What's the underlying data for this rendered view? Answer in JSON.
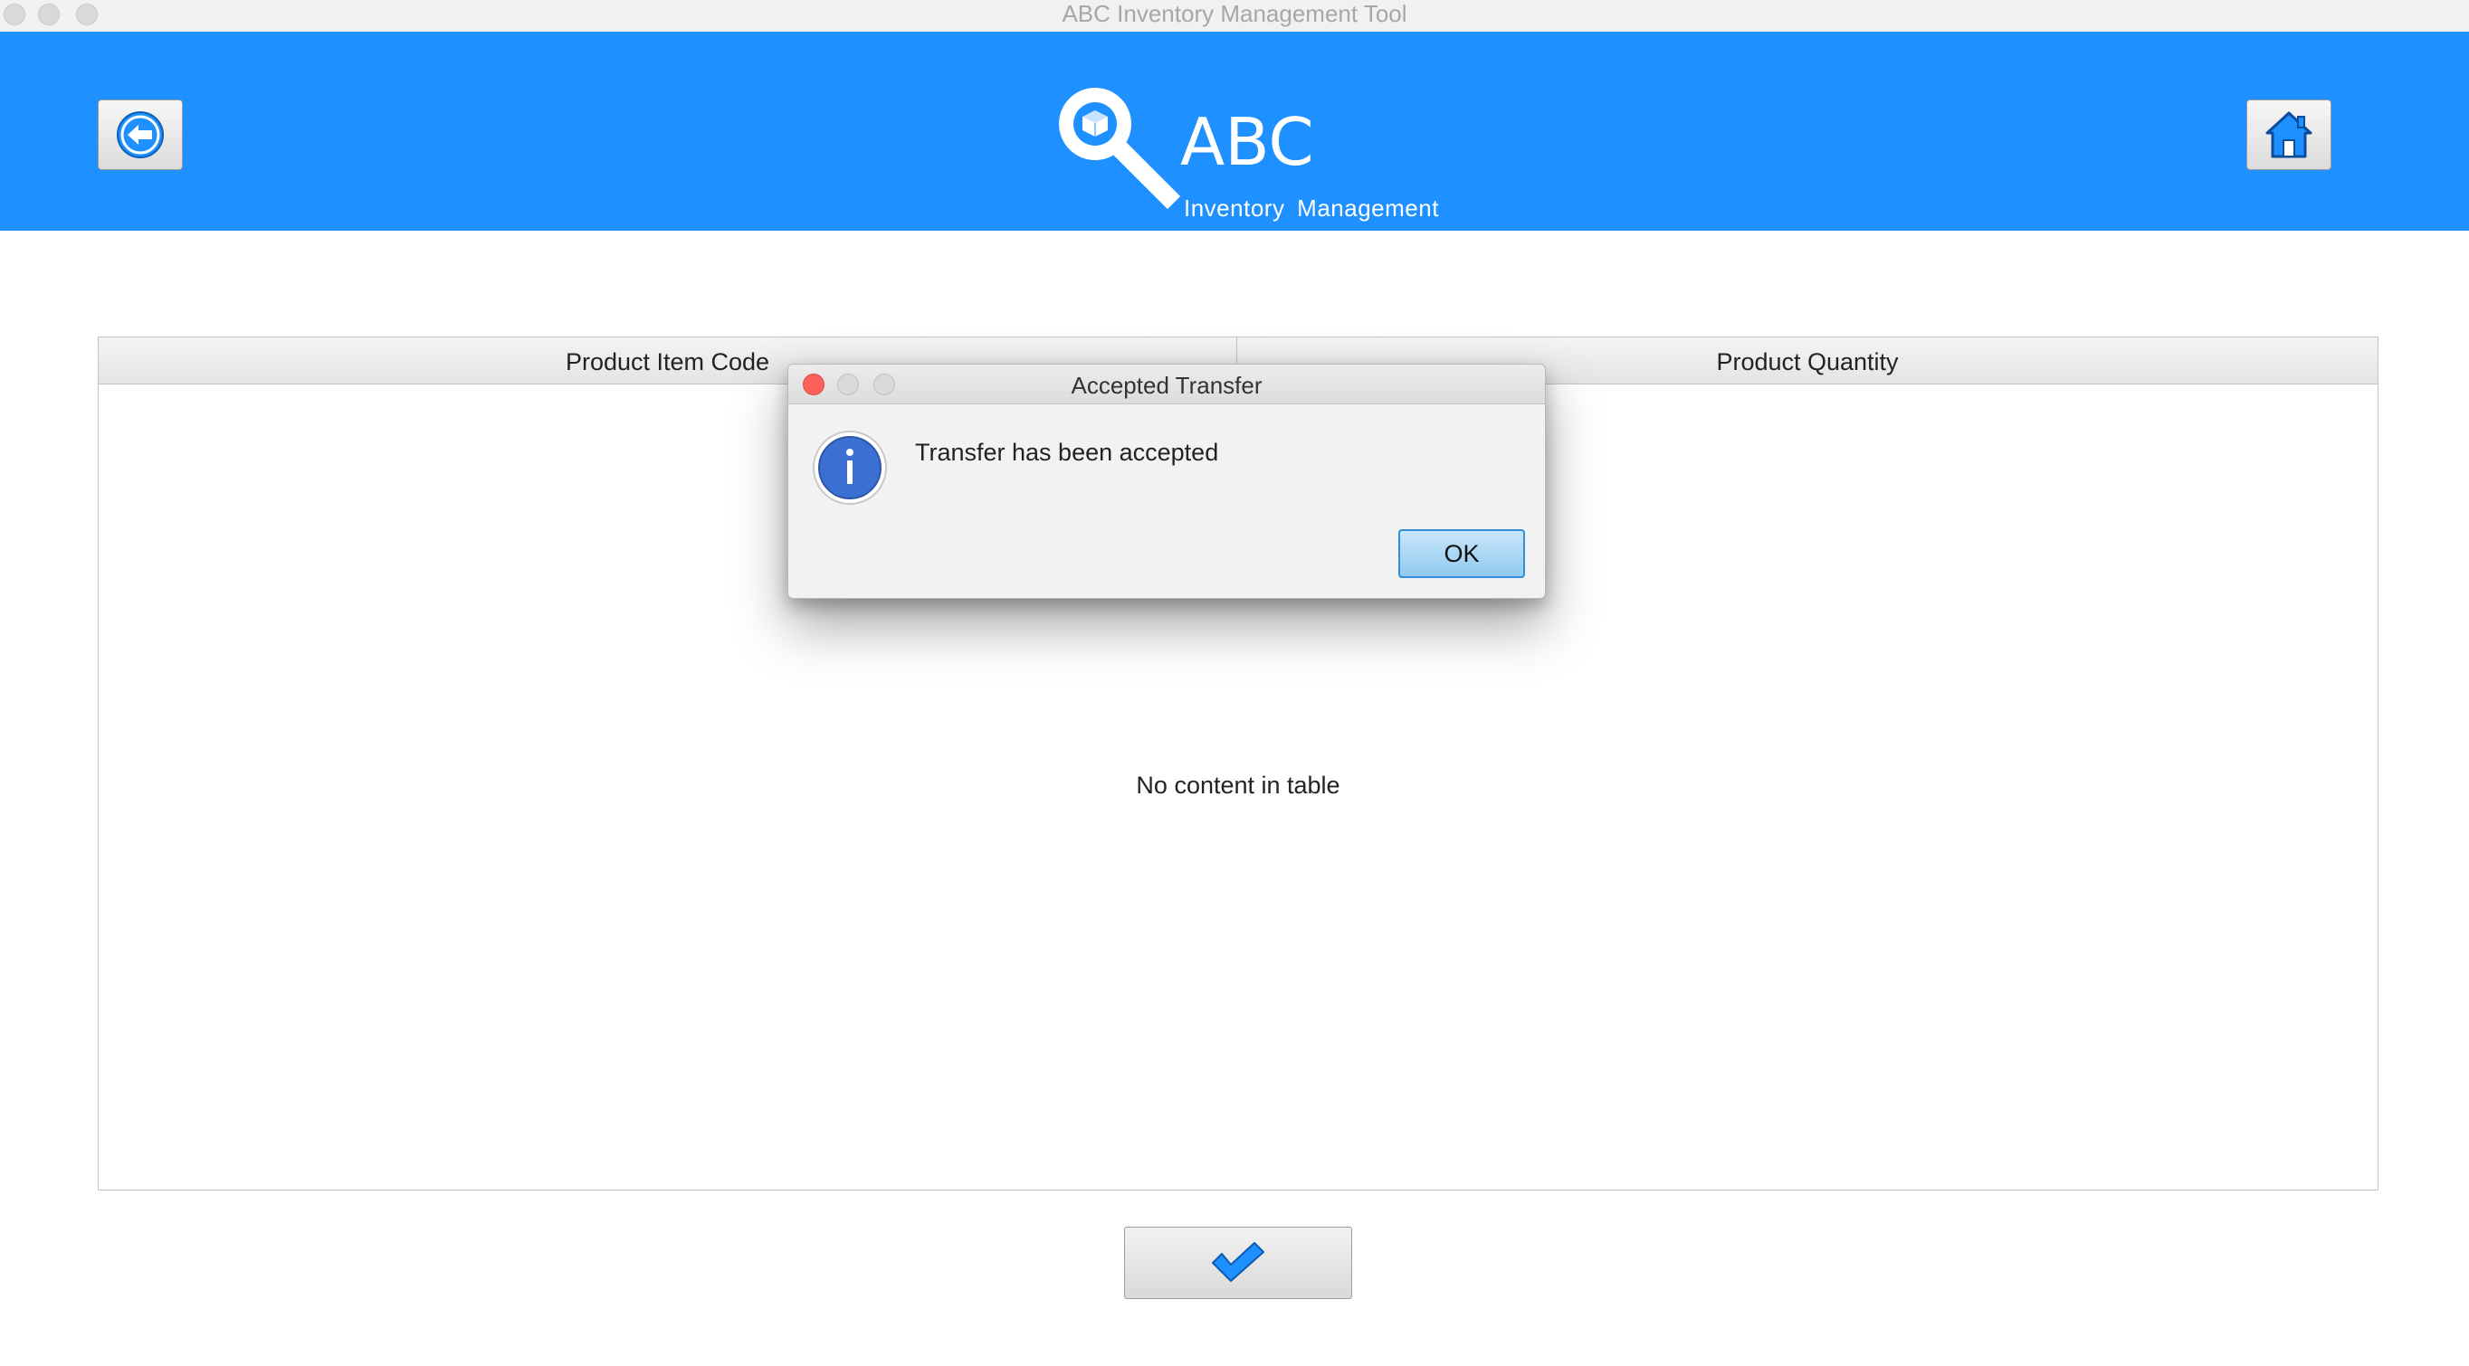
{
  "window": {
    "title": "ABC Inventory Management Tool"
  },
  "header": {
    "brand_title": "ABC",
    "brand_subtitle": "Inventory Management",
    "back_icon": "arrow-left-icon",
    "home_icon": "home-icon",
    "logo_icon": "magnifier-box-icon",
    "background_color": "#1e90ff"
  },
  "table": {
    "columns": [
      "Product Item Code",
      "Product Quantity"
    ],
    "rows": [],
    "placeholder": "No content in table"
  },
  "actions": {
    "confirm_icon": "checkmark-icon"
  },
  "dialog": {
    "title": "Accepted Transfer",
    "message": "Transfer has been accepted",
    "icon": "info-icon",
    "ok_label": "OK"
  }
}
